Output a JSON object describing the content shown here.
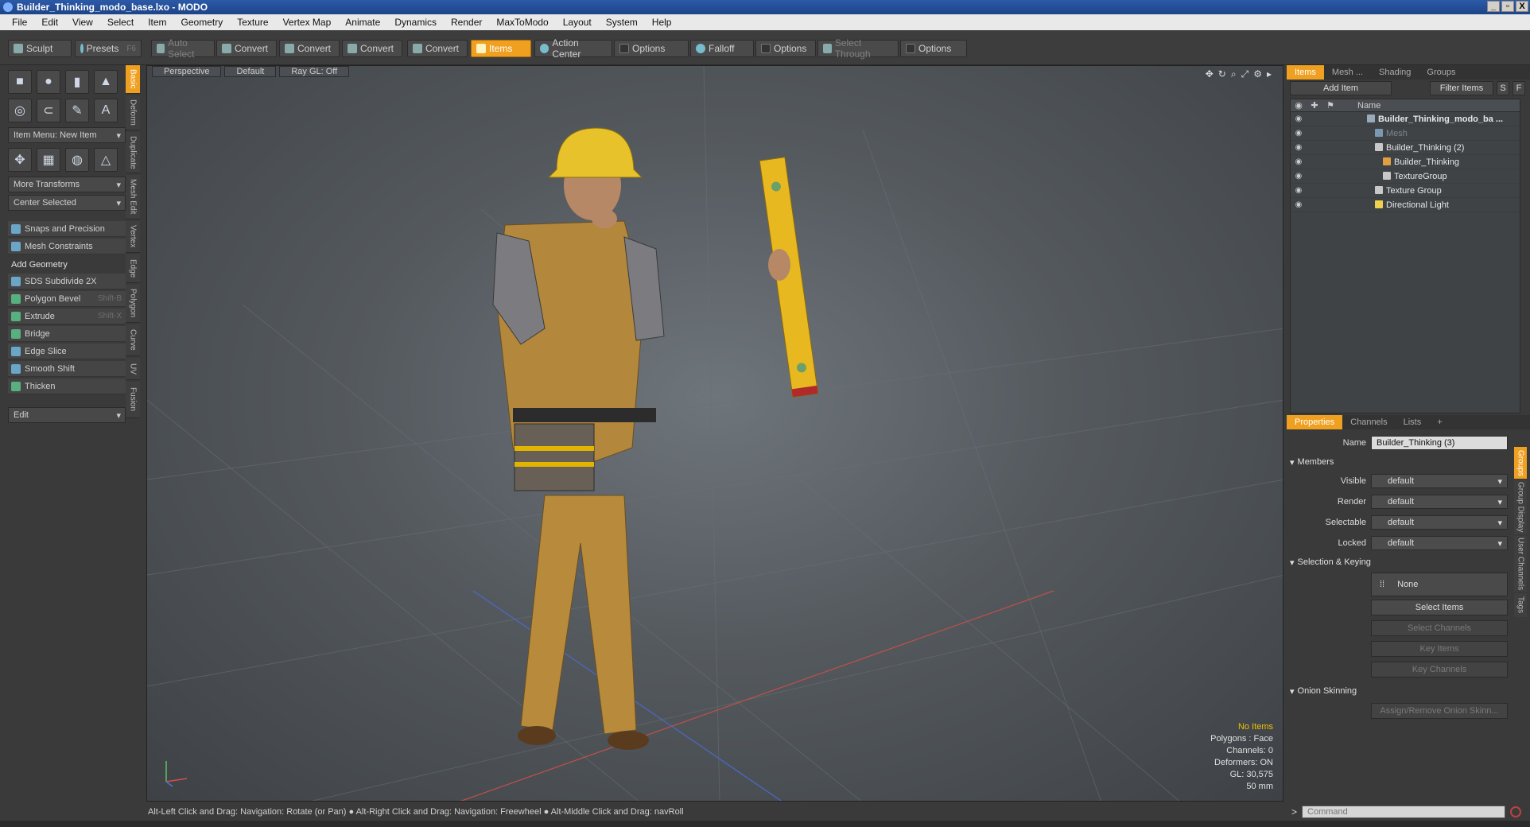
{
  "window": {
    "title": "Builder_Thinking_modo_base.lxo - MODO",
    "controls": [
      "_",
      "▫",
      "X"
    ]
  },
  "menu": [
    "File",
    "Edit",
    "View",
    "Select",
    "Item",
    "Geometry",
    "Texture",
    "Vertex Map",
    "Animate",
    "Dynamics",
    "Render",
    "MaxToModo",
    "Layout",
    "System",
    "Help"
  ],
  "toolbar": {
    "sculpt": "Sculpt",
    "presets": "Presets",
    "presets_key": "F6",
    "auto_select": "Auto Select",
    "convert1": "Convert",
    "convert2": "Convert",
    "convert3": "Convert",
    "convert4": "Convert",
    "items": "Items",
    "action_center": "Action Center",
    "options1": "Options",
    "falloff": "Falloff",
    "options2": "Options",
    "select_through": "Select Through",
    "options3": "Options"
  },
  "left": {
    "item_menu": "Item Menu: New Item",
    "more_transforms": "More Transforms",
    "center_selected": "Center Selected",
    "snaps": "Snaps and Precision",
    "mesh_constraints": "Mesh Constraints",
    "add_geometry": "Add Geometry",
    "tools": [
      {
        "label": "SDS Subdivide 2X",
        "key": ""
      },
      {
        "label": "Polygon Bevel",
        "key": "Shift-B"
      },
      {
        "label": "Extrude",
        "key": "Shift-X"
      },
      {
        "label": "Bridge",
        "key": ""
      },
      {
        "label": "Edge Slice",
        "key": ""
      },
      {
        "label": "Smooth Shift",
        "key": ""
      },
      {
        "label": "Thicken",
        "key": ""
      }
    ],
    "edit": "Edit",
    "vtabs": [
      "Basic",
      "Deform",
      "Duplicate",
      "Mesh Edit",
      "Vertex",
      "Edge",
      "Polygon",
      "Curve",
      "UV",
      "Fusion"
    ]
  },
  "viewport": {
    "tabs": [
      "Perspective",
      "Default",
      "Ray GL: Off"
    ],
    "stats": {
      "no_items": "No Items",
      "polygons": "Polygons : Face",
      "channels": "Channels: 0",
      "deformers": "Deformers: ON",
      "gl": "GL: 30,575",
      "mm": "50 mm"
    }
  },
  "status": "Alt-Left Click and Drag: Navigation: Rotate (or Pan) ● Alt-Right Click and Drag: Navigation: Freewheel ● Alt-Middle Click and Drag: navRoll",
  "right": {
    "tabs": [
      "Items",
      "Mesh ...",
      "Shading",
      "Groups"
    ],
    "add_item": "Add Item",
    "filter_items": "Filter Items",
    "s_btn": "S",
    "f_btn": "F",
    "name_col": "Name",
    "tree": [
      {
        "label": "Builder_Thinking_modo_ba ...",
        "indent": 0
      },
      {
        "label": "Mesh",
        "indent": 1
      },
      {
        "label": "Builder_Thinking (2)",
        "indent": 1
      },
      {
        "label": "Builder_Thinking",
        "indent": 2
      },
      {
        "label": "TextureGroup",
        "indent": 2
      },
      {
        "label": "Texture Group",
        "indent": 1
      },
      {
        "label": "Directional Light",
        "indent": 1
      }
    ],
    "prop_tabs": [
      "Properties",
      "Channels",
      "Lists",
      "+"
    ],
    "name_label": "Name",
    "name_value": "Builder_Thinking (3)",
    "members": "Members",
    "visible": "Visible",
    "render": "Render",
    "selectable": "Selectable",
    "locked": "Locked",
    "default_val": "default",
    "selection_keying": "Selection & Keying",
    "none": "None",
    "select_items": "Select Items",
    "select_channels": "Select Channels",
    "key_items": "Key Items",
    "key_channels": "Key Channels",
    "onion_skinning": "Onion Skinning",
    "assign_remove": "Assign/Remove Onion Skinn...",
    "right_vtabs": [
      "Groups",
      "Group Display",
      "User Channels",
      "Tags"
    ]
  },
  "command": {
    "prompt": ">",
    "placeholder": "Command"
  }
}
